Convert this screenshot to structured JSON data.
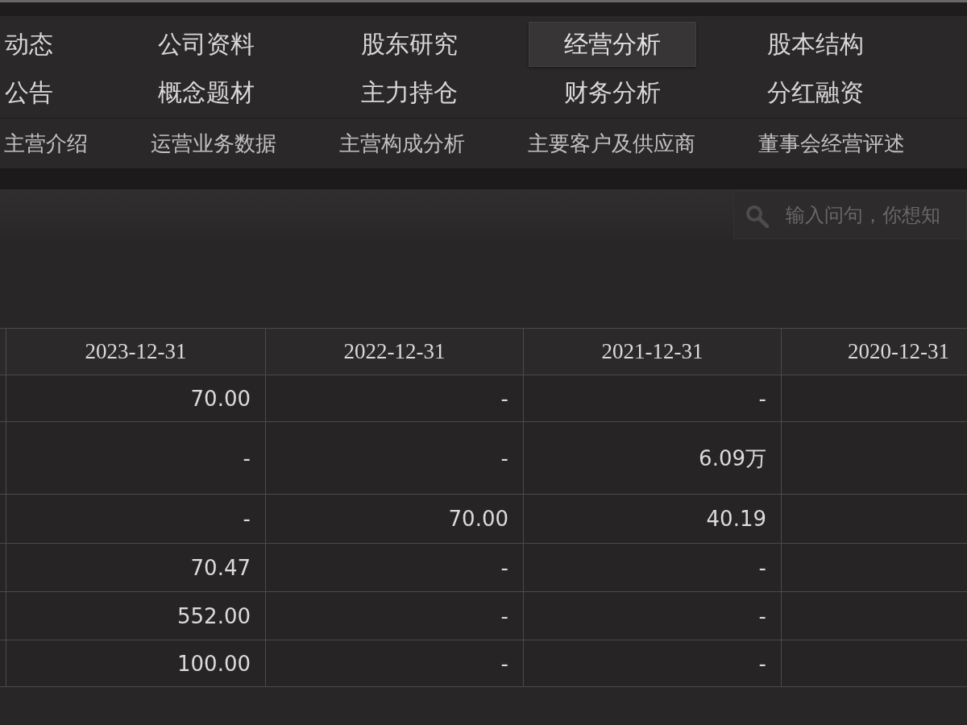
{
  "nav_rows": [
    [
      {
        "label": "动态",
        "selected": false
      },
      {
        "label": "公司资料",
        "selected": false
      },
      {
        "label": "股东研究",
        "selected": false
      },
      {
        "label": "经营分析",
        "selected": true
      },
      {
        "label": "股本结构",
        "selected": false
      }
    ],
    [
      {
        "label": "公告",
        "selected": false
      },
      {
        "label": "概念题材",
        "selected": false
      },
      {
        "label": "主力持仓",
        "selected": false
      },
      {
        "label": "财务分析",
        "selected": false
      },
      {
        "label": "分红融资",
        "selected": false
      }
    ]
  ],
  "sub_tabs": [
    {
      "label": "主营介绍"
    },
    {
      "label": "运营业务数据"
    },
    {
      "label": "主营构成分析"
    },
    {
      "label": "主要客户及供应商"
    },
    {
      "label": "董事会经营评述"
    }
  ],
  "search": {
    "placeholder": "输入问句，你想知"
  },
  "table": {
    "columns": [
      "2023-12-31",
      "2022-12-31",
      "2021-12-31",
      "2020-12-31"
    ],
    "rows": [
      [
        "70.00",
        "-",
        "-"
      ],
      [
        "-",
        "-",
        "6.09万"
      ],
      [
        "-",
        "70.00",
        "40.19"
      ],
      [
        "70.47",
        "-",
        "-"
      ],
      [
        "552.00",
        "-",
        "-"
      ],
      [
        "100.00",
        "-",
        "-"
      ]
    ]
  }
}
